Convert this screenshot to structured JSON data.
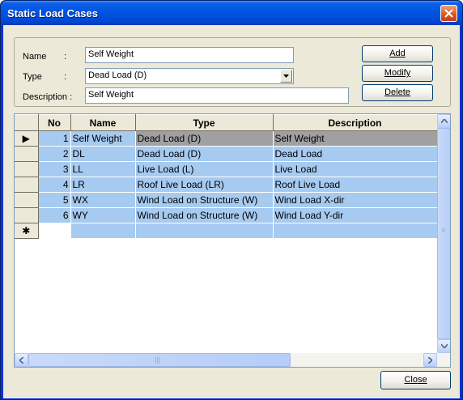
{
  "window": {
    "title": "Static Load Cases"
  },
  "form": {
    "name_label": "Name",
    "name_colon": ":",
    "name_value": "Self Weight",
    "type_label": "Type",
    "type_colon": ":",
    "type_value": "Dead Load (D)",
    "description_label": "Description :",
    "description_value": "Self Weight"
  },
  "buttons": {
    "add": "Add",
    "modify": "Modify",
    "delete": "Delete",
    "close": "Close"
  },
  "grid": {
    "columns": [
      "No",
      "Name",
      "Type",
      "Description"
    ],
    "rows": [
      {
        "no": "1",
        "name": "Self Weight",
        "type": "Dead Load (D)",
        "description": "Self Weight"
      },
      {
        "no": "2",
        "name": "DL",
        "type": "Dead Load (D)",
        "description": "Dead Load"
      },
      {
        "no": "3",
        "name": "LL",
        "type": "Live Load (L)",
        "description": "Live Load"
      },
      {
        "no": "4",
        "name": "LR",
        "type": "Roof Live Load (LR)",
        "description": "Roof Live Load"
      },
      {
        "no": "5",
        "name": "WX",
        "type": "Wind Load on Structure (W)",
        "description": "Wind Load X-dir"
      },
      {
        "no": "6",
        "name": "WY",
        "type": "Wind Load on Structure (W)",
        "description": "Wind Load Y-dir"
      }
    ],
    "current_row_marker": "▶",
    "new_row_marker": "✱"
  },
  "colors": {
    "titlebar": "#0053e0",
    "dialog_bg": "#ece9d8",
    "row_bg": "#a6caf0",
    "selected_cell": "#a0a0a0"
  },
  "icons": {
    "close": "close-icon",
    "dropdown": "chevron-down-icon",
    "scroll_up": "arrow-up-icon",
    "scroll_down": "arrow-down-icon",
    "scroll_left": "arrow-left-icon",
    "scroll_right": "arrow-right-icon"
  }
}
